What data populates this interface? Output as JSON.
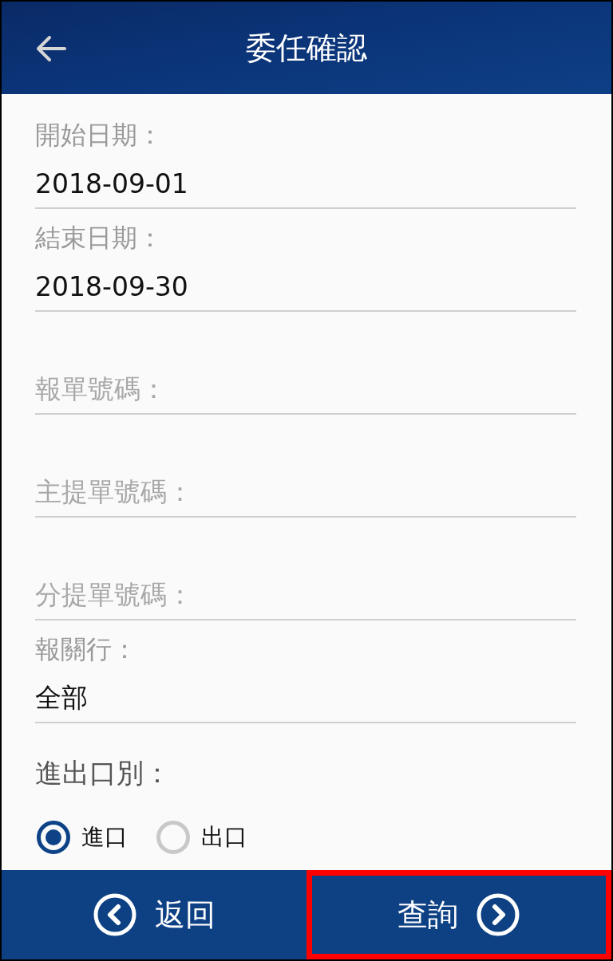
{
  "header": {
    "title": "委任確認"
  },
  "fields": [
    {
      "label": "開始日期：",
      "value": "2018-09-01"
    },
    {
      "label": "結束日期：",
      "value": "2018-09-30"
    },
    {
      "placeholder": "報單號碼："
    },
    {
      "placeholder": "主提單號碼："
    },
    {
      "placeholder": "分提單號碼："
    },
    {
      "label": "報關行：",
      "value": "全部"
    }
  ],
  "direction": {
    "label": "進出口別：",
    "options": [
      {
        "label": "進口",
        "selected": true
      },
      {
        "label": "出口",
        "selected": false
      }
    ]
  },
  "footer": [
    {
      "kind": "back",
      "label": "返回",
      "highlighted": false
    },
    {
      "kind": "next",
      "label": "查詢",
      "highlighted": true
    }
  ]
}
